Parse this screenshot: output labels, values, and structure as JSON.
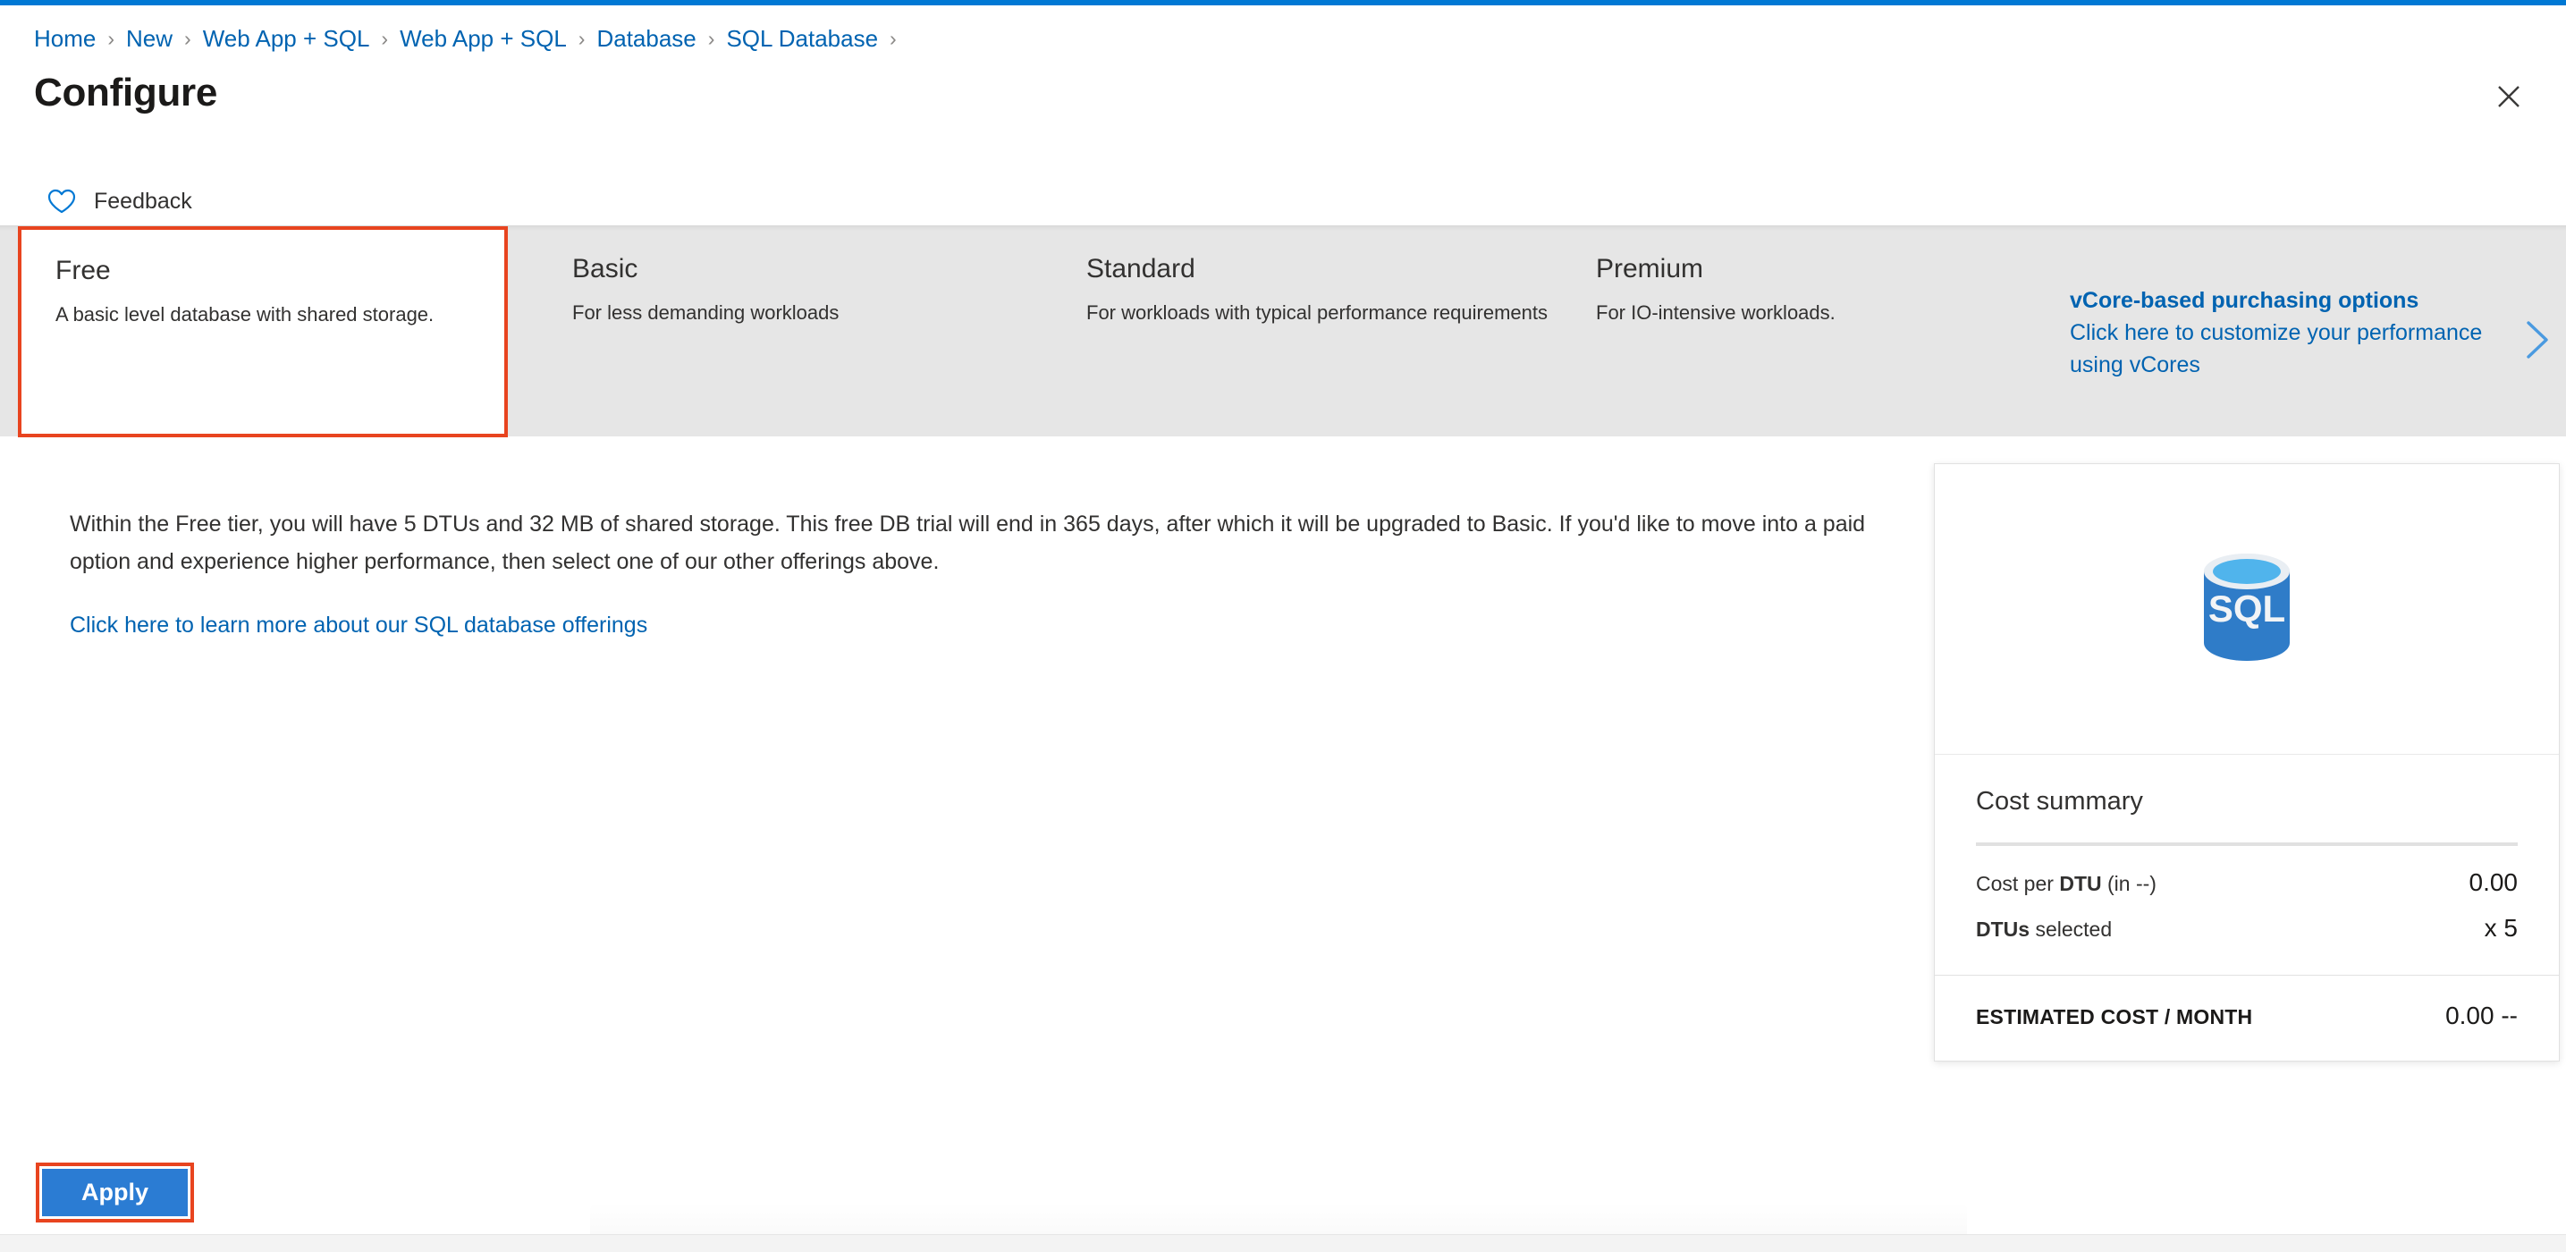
{
  "accent": {
    "brand_blue": "#0078d4",
    "link_blue": "#0063b1",
    "highlight_red": "#e8441f",
    "button_blue": "#2b7cd3",
    "strip_gray": "#e6e6e6"
  },
  "breadcrumb": {
    "separator": "›",
    "items": [
      {
        "label": "Home"
      },
      {
        "label": "New"
      },
      {
        "label": "Web App + SQL"
      },
      {
        "label": "Web App + SQL"
      },
      {
        "label": "Database"
      },
      {
        "label": "SQL Database"
      }
    ]
  },
  "header": {
    "title": "Configure",
    "close_icon": "close-icon"
  },
  "toolbar": {
    "feedback_label": "Feedback",
    "feedback_icon": "heart-icon"
  },
  "tiers": [
    {
      "name": "Free",
      "description": "A basic level database with shared storage.",
      "selected": true
    },
    {
      "name": "Basic",
      "description": "For less demanding workloads",
      "selected": false
    },
    {
      "name": "Standard",
      "description": "For workloads with typical performance requirements",
      "selected": false
    },
    {
      "name": "Premium",
      "description": "For IO-intensive workloads.",
      "selected": false
    }
  ],
  "vcore": {
    "title": "vCore-based purchasing options",
    "subtitle": "Click here to customize your performance using vCores",
    "chevron_icon": "chevron-right-icon"
  },
  "main": {
    "description": "Within the Free tier, you will have 5 DTUs and 32 MB of shared storage. This free DB trial will end in 365 days, after which it will be upgraded to Basic. If you'd like to move into a paid option and experience higher performance, then select one of our other offerings above.",
    "learn_more_link": "Click here to learn more about our SQL database offerings"
  },
  "cost_summary": {
    "product_icon": "sql-database-icon",
    "product_icon_text": "SQL",
    "heading": "Cost summary",
    "rows": [
      {
        "label_prefix": "Cost per ",
        "label_bold": "DTU",
        "label_suffix": " (in --)",
        "value": "0.00"
      },
      {
        "label_prefix": "",
        "label_bold": "DTUs",
        "label_suffix": " selected",
        "value": "x 5"
      }
    ],
    "total_label": "ESTIMATED COST / MONTH",
    "total_value": "0.00 --"
  },
  "footer": {
    "apply_label": "Apply"
  }
}
